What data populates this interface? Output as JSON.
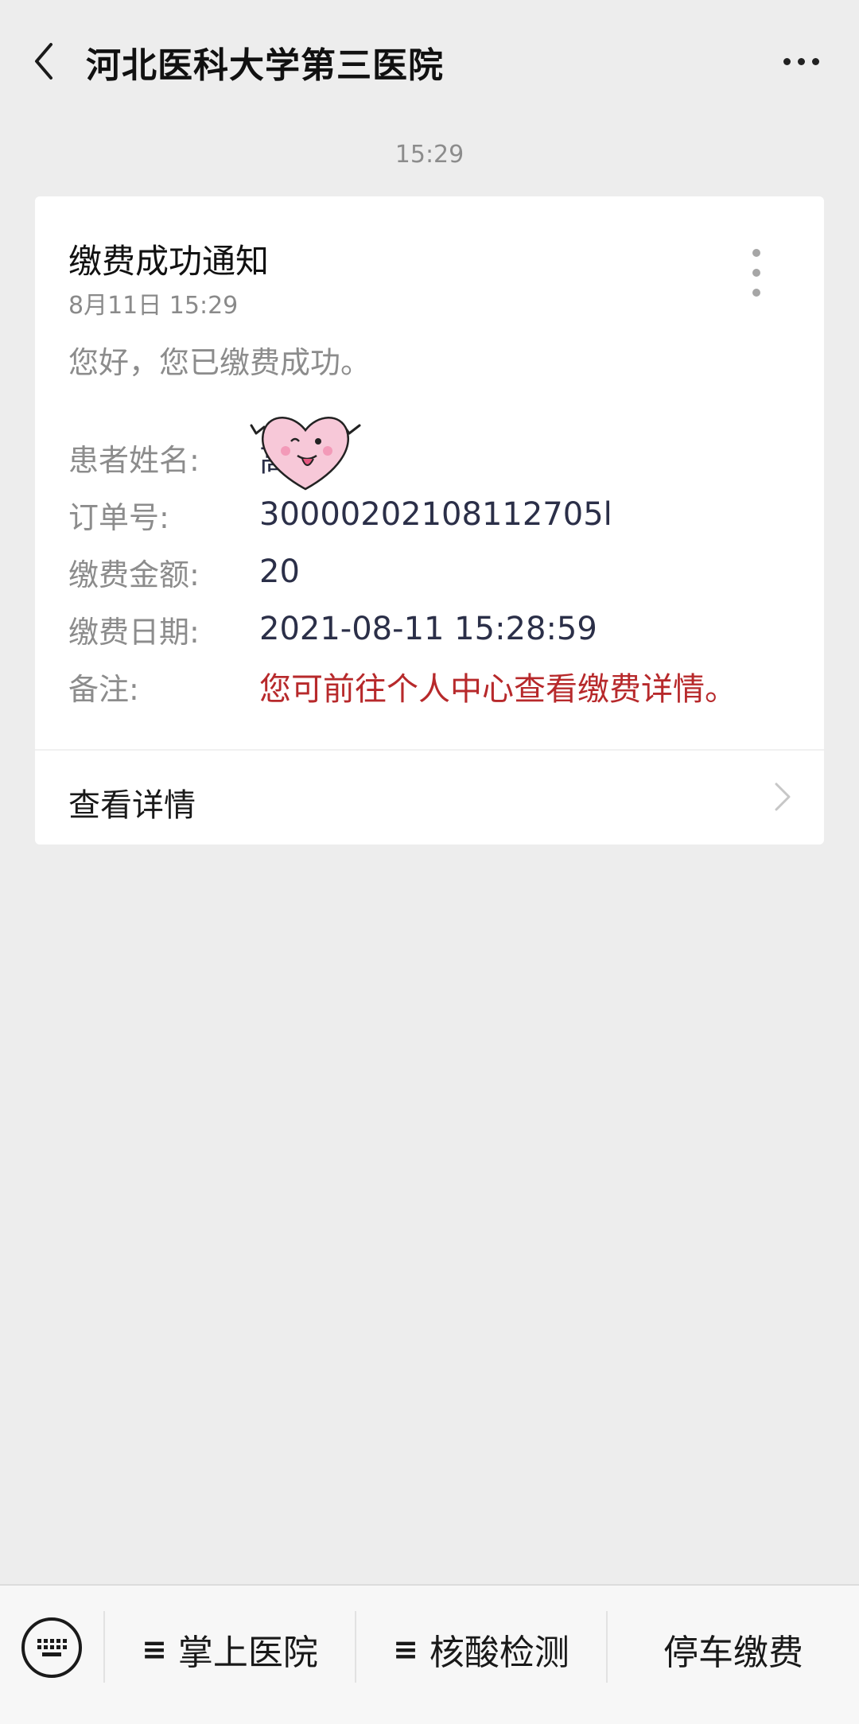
{
  "header": {
    "title": "河北医科大学第三医院",
    "back_icon": "chevron-left-icon",
    "more_icon": "more-dots-icon"
  },
  "timestamp": "15:29",
  "card": {
    "title": "缴费成功通知",
    "date": "8月11日  15:29",
    "greeting": "您好，您已缴费成功。",
    "fields": [
      {
        "label": "患者姓名:",
        "value": "高  飞"
      },
      {
        "label": "订单号:",
        "value": "30000202108112705l"
      },
      {
        "label": "缴费金额:",
        "value": "20"
      },
      {
        "label": "缴费日期:",
        "value": "2021-08-11 15:28:59"
      },
      {
        "label": "备注:",
        "value": "您可前往个人中心查看缴费详情。"
      }
    ],
    "remark_color": "#b7292b",
    "detail_label": "查看详情"
  },
  "bottom_menu": {
    "keyboard_icon": "keyboard-icon",
    "items": [
      {
        "icon": "≡",
        "label": "掌上医院"
      },
      {
        "icon": "≡",
        "label": "核酸检测"
      },
      {
        "icon": "",
        "label": "停车缴费"
      }
    ]
  }
}
